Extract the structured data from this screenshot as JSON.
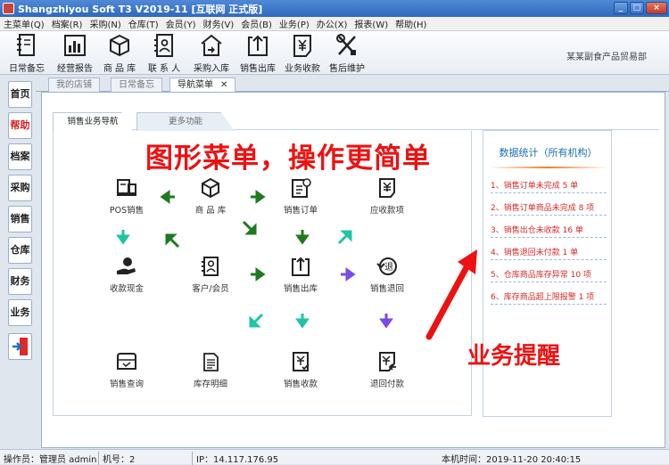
{
  "window": {
    "title": "Shangzhiyou Soft T3 V2019-11 [互联网 正式版]",
    "controls": [
      "_",
      "□",
      "×"
    ]
  },
  "menu": [
    "主菜单(Q)",
    "档案(R)",
    "采购(N)",
    "仓库(T)",
    "会员(Y)",
    "财务(V)",
    "会员(B)",
    "业务(P)",
    "办公(X)",
    "报表(W)",
    "帮助(H)"
  ],
  "toolbar": {
    "items": [
      {
        "label": "日常备忘",
        "icon": "notebook-icon"
      },
      {
        "label": "经营报告",
        "icon": "bar-chart-icon"
      },
      {
        "label": "商 品 库",
        "icon": "box-icon"
      },
      {
        "label": "联 系 人",
        "icon": "contacts-icon"
      },
      {
        "label": "采购入库",
        "icon": "warehouse-in-icon"
      },
      {
        "label": "销售出库",
        "icon": "upload-box-icon"
      },
      {
        "label": "业务收款",
        "icon": "yen-doc-icon"
      },
      {
        "label": "售后维护",
        "icon": "tools-icon"
      }
    ],
    "company": "某某副食产品贸易部"
  },
  "sidebar": [
    "首页",
    "帮助",
    "档案",
    "采购",
    "销售",
    "仓库",
    "财务",
    "业务"
  ],
  "tabs": [
    {
      "label": "我的店铺",
      "active": false
    },
    {
      "label": "日常备忘",
      "active": false
    },
    {
      "label": "导航菜单",
      "active": true,
      "close": "✕"
    }
  ],
  "subtabs": [
    {
      "label": "销售业务导航",
      "active": true
    },
    {
      "label": "更多功能",
      "active": false
    }
  ],
  "headline": "图形菜单，操作更简单",
  "nodes": {
    "pos": "POS销售",
    "goods": "商 品 库",
    "order": "销售订单",
    "receivable": "应收款项",
    "collect": "收款现金",
    "customer": "客户/会员",
    "outbound": "销售出库",
    "return": "销售退回",
    "query": "销售查询",
    "stock": "库存明细",
    "income": "销售收款",
    "refund": "退回付款"
  },
  "stats": {
    "title": "数据统计（所有机构）",
    "items": [
      "1、销售订单未完成 5 单",
      "2、销售订单商品未完成 8 项",
      "3、销售出仓未收款 16 单",
      "4、销售退回未付款 1 单",
      "5、仓库商品库存异常 10 项",
      "6、库存商品超上限报警 1 项"
    ]
  },
  "reminder": "业务提醒",
  "status": {
    "operator": "操作员：管理员 admin",
    "machine": "机号：2",
    "ip": "IP：14.117.176.95",
    "time": "本机时间：2019-11-20 20:40:15"
  },
  "colors": {
    "accent_red": "#ee1111",
    "arrow_green": "#1f7a1f",
    "arrow_teal": "#21c4a4",
    "arrow_purple": "#7a4be8",
    "title_blue": "#2f69bd"
  }
}
